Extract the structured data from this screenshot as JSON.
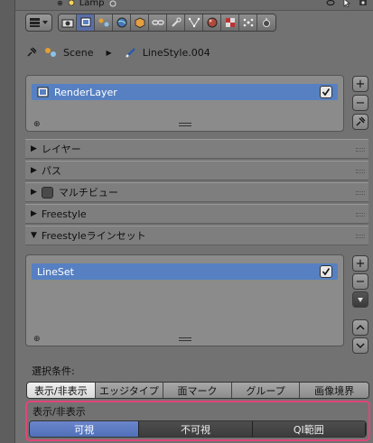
{
  "topbar": {
    "object_label": "Lamp"
  },
  "breadcrumb": {
    "scene": "Scene",
    "linestyle": "LineStyle.004"
  },
  "render_layers": {
    "items": [
      {
        "label": "RenderLayer",
        "checked": true
      }
    ]
  },
  "panels": [
    {
      "label": "レイヤー",
      "expanded": false
    },
    {
      "label": "パス",
      "expanded": false
    },
    {
      "label": "マルチビュー",
      "expanded": false,
      "has_checkbox": true
    },
    {
      "label": "Freestyle",
      "expanded": false
    },
    {
      "label": "Freestyleラインセット",
      "expanded": true
    }
  ],
  "linesets": {
    "items": [
      {
        "label": "LineSet",
        "checked": true
      }
    ]
  },
  "selection": {
    "label": "選択条件:",
    "tabs": [
      "表示/非表示",
      "エッジタイプ",
      "面マーク",
      "グループ",
      "画像境界"
    ],
    "active_tab": "表示/非表示"
  },
  "visibility": {
    "label": "表示/非表示",
    "options": [
      "可視",
      "不可視",
      "QI範囲"
    ],
    "active": "可視"
  },
  "colors": {
    "selected_row": "#5680c2",
    "highlight_border": "#e0457a",
    "active_segment": "#5070b8"
  }
}
